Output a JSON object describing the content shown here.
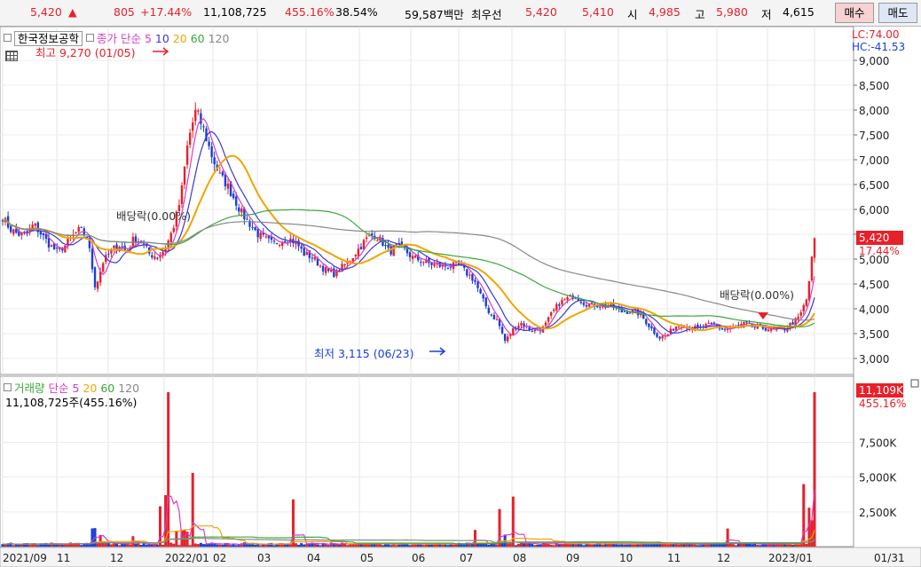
{
  "quote_bar": {
    "price": "5,420",
    "up_arrow": "▲",
    "change": "805",
    "change_pct": "+17.44%",
    "volume": "11,108,725",
    "volume_ratio": "455.16%",
    "turnover": "38.54%",
    "amount": "59,587백만",
    "best_label": "최우선",
    "best_ask": "5,420",
    "best_bid": "5,410",
    "open_label": "시",
    "open": "4,985",
    "high_label": "고",
    "high": "5,980",
    "low_label": "저",
    "low": "4,615",
    "buy_button": "매수",
    "sell_button": "매도"
  },
  "price_panel": {
    "stock_name": "한국정보공학",
    "indicator_label": "종가 단순",
    "ma_periods": [
      "5",
      "10",
      "20",
      "60",
      "120"
    ],
    "lc_label": "LC:74.00",
    "hc_label": "HC:-41.53",
    "high_annotation": "최고 9,270 (01/05)",
    "low_annotation": "최저 3,115 (06/23)",
    "dividend_annotation_1": "배당락(0.00%)",
    "dividend_annotation_2": "배당락(0.00%)",
    "current_price_box": "5,420",
    "current_pct": "17.44%",
    "y_ticks": [
      "9,000",
      "8,500",
      "8,000",
      "7,500",
      "7,000",
      "6,500",
      "6,000",
      "5,500",
      "5,000",
      "4,500",
      "4,000",
      "3,500",
      "3,000"
    ]
  },
  "volume_panel": {
    "label": "거래량",
    "indicator_label": "단순",
    "ma_periods": [
      "5",
      "20",
      "60",
      "120"
    ],
    "summary": "11,108,725주(455.16%)",
    "current_box": "11,109K",
    "current_pct": "455.16%",
    "y_ticks": [
      "7,500K",
      "5,000K",
      "2,500K"
    ]
  },
  "x_axis": [
    "2021/09",
    "11",
    "12",
    "2022/01",
    "02",
    "03",
    "04",
    "05",
    "06",
    "07",
    "08",
    "09",
    "10",
    "11",
    "12",
    "2023/01",
    "01/31"
  ],
  "colors": {
    "up": "#e8202a",
    "down": "#1a3fd8",
    "ma5": "#d63cc8",
    "ma10": "#3a3ad8",
    "ma20": "#f0a500",
    "ma60": "#3aa83a",
    "ma120": "#888888"
  },
  "chart_data": {
    "type": "candlestick",
    "price_range": [
      3000,
      9000
    ],
    "volume_range_k": [
      0,
      11109
    ],
    "closes": [
      5840,
      5600,
      5500,
      5480,
      5700,
      5500,
      5300,
      5150,
      5260,
      5450,
      5600,
      5400,
      4420,
      4950,
      5150,
      5300,
      5150,
      5420,
      5350,
      5100,
      5050,
      5200,
      5600,
      6200,
      7400,
      8000,
      7600,
      7100,
      6700,
      6500,
      6200,
      5900,
      5700,
      5500,
      5400,
      5300,
      5380,
      5420,
      5320,
      5100,
      5050,
      4880,
      4750,
      4700,
      4850,
      5000,
      5200,
      5400,
      5500,
      5360,
      5140,
      5260,
      5180,
      5030,
      4980,
      4920,
      4880,
      4860,
      4860,
      4870,
      4720,
      4580,
      4200,
      3910,
      3760,
      3340,
      3580,
      3720,
      3600,
      3560,
      3620,
      3900,
      4120,
      4200,
      4280,
      4140,
      4070,
      4080,
      4050,
      4030,
      3940,
      3950,
      3940,
      3780,
      3580,
      3420,
      3480,
      3650,
      3690,
      3620,
      3600,
      3660,
      3680,
      3590,
      3600,
      3640,
      3700,
      3630,
      3620,
      3600,
      3560,
      3580,
      3700,
      3820,
      4200,
      5420
    ]
  }
}
